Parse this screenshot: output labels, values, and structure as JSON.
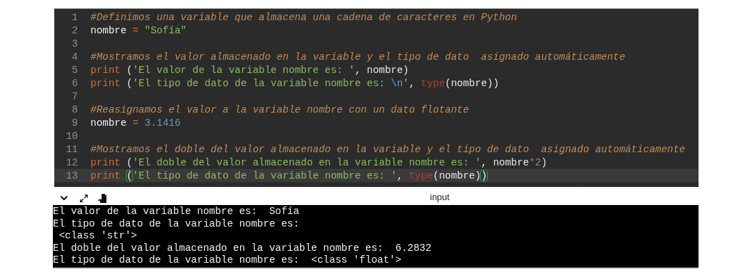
{
  "editor": {
    "lines": [
      {
        "number": "1",
        "current": false,
        "tokens": [
          {
            "kind": "comment",
            "text": "#Definimos una variable que almacena una cadena de caracteres en Python"
          }
        ]
      },
      {
        "number": "2",
        "current": false,
        "tokens": [
          {
            "kind": "name",
            "text": "nombre"
          },
          {
            "kind": "operator",
            "text": " = "
          },
          {
            "kind": "string",
            "text": "\"Sofía\""
          }
        ]
      },
      {
        "number": "3",
        "current": false
      },
      {
        "number": "4",
        "current": false,
        "tokens": [
          {
            "kind": "comment",
            "text": "#Mostramos el valor almacenado en la variable y el tipo de dato  asignado automáticamente"
          }
        ]
      },
      {
        "number": "5",
        "current": false,
        "tokens": [
          {
            "kind": "keyword",
            "text": "print"
          },
          {
            "kind": "plain",
            "text": " ("
          },
          {
            "kind": "string",
            "text": "'El valor de la variable nombre es: '"
          },
          {
            "kind": "plain",
            "text": ", nombre)"
          }
        ]
      },
      {
        "number": "6",
        "current": false,
        "tokens": [
          {
            "kind": "keyword",
            "text": "print"
          },
          {
            "kind": "plain",
            "text": " ("
          },
          {
            "kind": "string",
            "text": "'El tipo de dato de la variable nombre es: "
          },
          {
            "kind": "escape",
            "text": "\\n"
          },
          {
            "kind": "string",
            "text": "'"
          },
          {
            "kind": "plain",
            "text": ", "
          },
          {
            "kind": "builtin",
            "text": "type"
          },
          {
            "kind": "plain",
            "text": "(nombre))"
          }
        ]
      },
      {
        "number": "7",
        "current": false
      },
      {
        "number": "8",
        "current": false,
        "tokens": [
          {
            "kind": "comment",
            "text": "#Reasignamos el valor a la variable nombre con un dato flotante"
          }
        ]
      },
      {
        "number": "9",
        "current": false,
        "tokens": [
          {
            "kind": "name",
            "text": "nombre"
          },
          {
            "kind": "operator",
            "text": " = "
          },
          {
            "kind": "number",
            "text": "3.1416"
          }
        ]
      },
      {
        "number": "10",
        "current": false
      },
      {
        "number": "11",
        "current": false,
        "tokens": [
          {
            "kind": "comment",
            "text": "#Mostramos el doble del valor almacenado en la variable y el tipo de dato  asignado automáticamente"
          }
        ]
      },
      {
        "number": "12",
        "current": false,
        "tokens": [
          {
            "kind": "keyword",
            "text": "print"
          },
          {
            "kind": "plain",
            "text": " ("
          },
          {
            "kind": "string",
            "text": "'El doble del valor almacenado en la variable nombre es: '"
          },
          {
            "kind": "plain",
            "text": ", nombre"
          },
          {
            "kind": "operator",
            "text": "*"
          },
          {
            "kind": "number",
            "text": "2"
          },
          {
            "kind": "plain",
            "text": ")"
          }
        ]
      },
      {
        "number": "13",
        "current": true,
        "tokens": [
          {
            "kind": "keyword",
            "text": "print "
          },
          {
            "kind": "bracket_match",
            "text": "("
          },
          {
            "kind": "string",
            "text": "'El tipo de dato de la variable nombre es: '"
          },
          {
            "kind": "plain",
            "text": ", "
          },
          {
            "kind": "builtin",
            "text": "type"
          },
          {
            "kind": "plain",
            "text": "(nombre)"
          },
          {
            "kind": "bracket_match",
            "text": ")"
          }
        ]
      }
    ]
  },
  "console": {
    "title": "input",
    "output": [
      "El valor de la variable nombre es:  Sofía",
      "El tipo de dato de la variable nombre es: ",
      " <class 'str'>",
      "El doble del valor almacenado en la variable nombre es:  6.2832",
      "El tipo de dato de la variable nombre es:  <class 'float'>"
    ]
  }
}
